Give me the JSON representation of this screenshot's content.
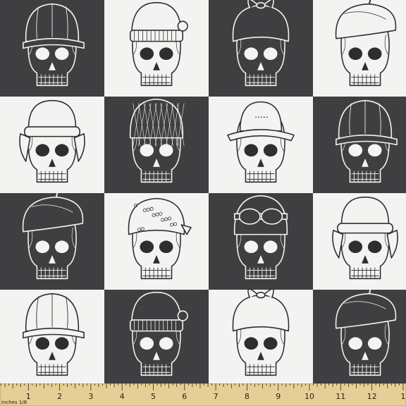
{
  "pattern": {
    "colors": {
      "dark": "#3f3f41",
      "light": "#f3f3f1",
      "ruler": "#e6cf96",
      "ruler_edge": "#b89a55"
    },
    "tiles": [
      {
        "bg": "dark",
        "hat": "cap"
      },
      {
        "bg": "light",
        "hat": "beanie"
      },
      {
        "bg": "dark",
        "hat": "bandana"
      },
      {
        "bg": "light",
        "hat": "beret"
      },
      {
        "bg": "light",
        "hat": "ushanka"
      },
      {
        "bg": "dark",
        "hat": "net"
      },
      {
        "bg": "light",
        "hat": "bucket"
      },
      {
        "bg": "dark",
        "hat": "cap"
      },
      {
        "bg": "dark",
        "hat": "beret"
      },
      {
        "bg": "light",
        "hat": "bandana-print"
      },
      {
        "bg": "dark",
        "hat": "goggles"
      },
      {
        "bg": "light",
        "hat": "ushanka"
      },
      {
        "bg": "light",
        "hat": "cap"
      },
      {
        "bg": "dark",
        "hat": "beanie"
      },
      {
        "bg": "light",
        "hat": "bandana"
      },
      {
        "bg": "dark",
        "hat": "beret"
      }
    ]
  },
  "ruler": {
    "unit_label": "inches 1/8",
    "numbers": [
      "1",
      "2",
      "3",
      "4",
      "5",
      "6",
      "7",
      "8",
      "9",
      "10",
      "11",
      "12",
      "1"
    ]
  }
}
